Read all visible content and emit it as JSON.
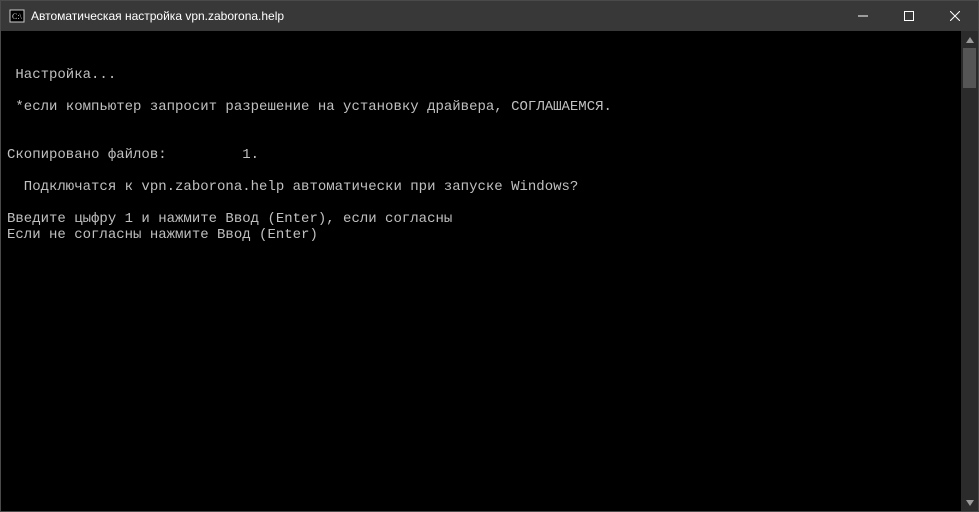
{
  "window": {
    "title": "Автоматическая настройка vpn.zaborona.help"
  },
  "console": {
    "lines": [
      "",
      "",
      " Настройка...",
      "",
      " *если компьютер запросит разрешение на установку драйвера, СОГЛАШАЕМСЯ.",
      "",
      "",
      "Скопировано файлов:         1.",
      "",
      "  Подключатся к vpn.zaborona.help автоматически при запуске Windows?",
      "",
      "Введите цыфру 1 и нажмите Ввод (Enter), если согласны",
      "Если не согласны нажмите Ввод (Enter)"
    ]
  }
}
